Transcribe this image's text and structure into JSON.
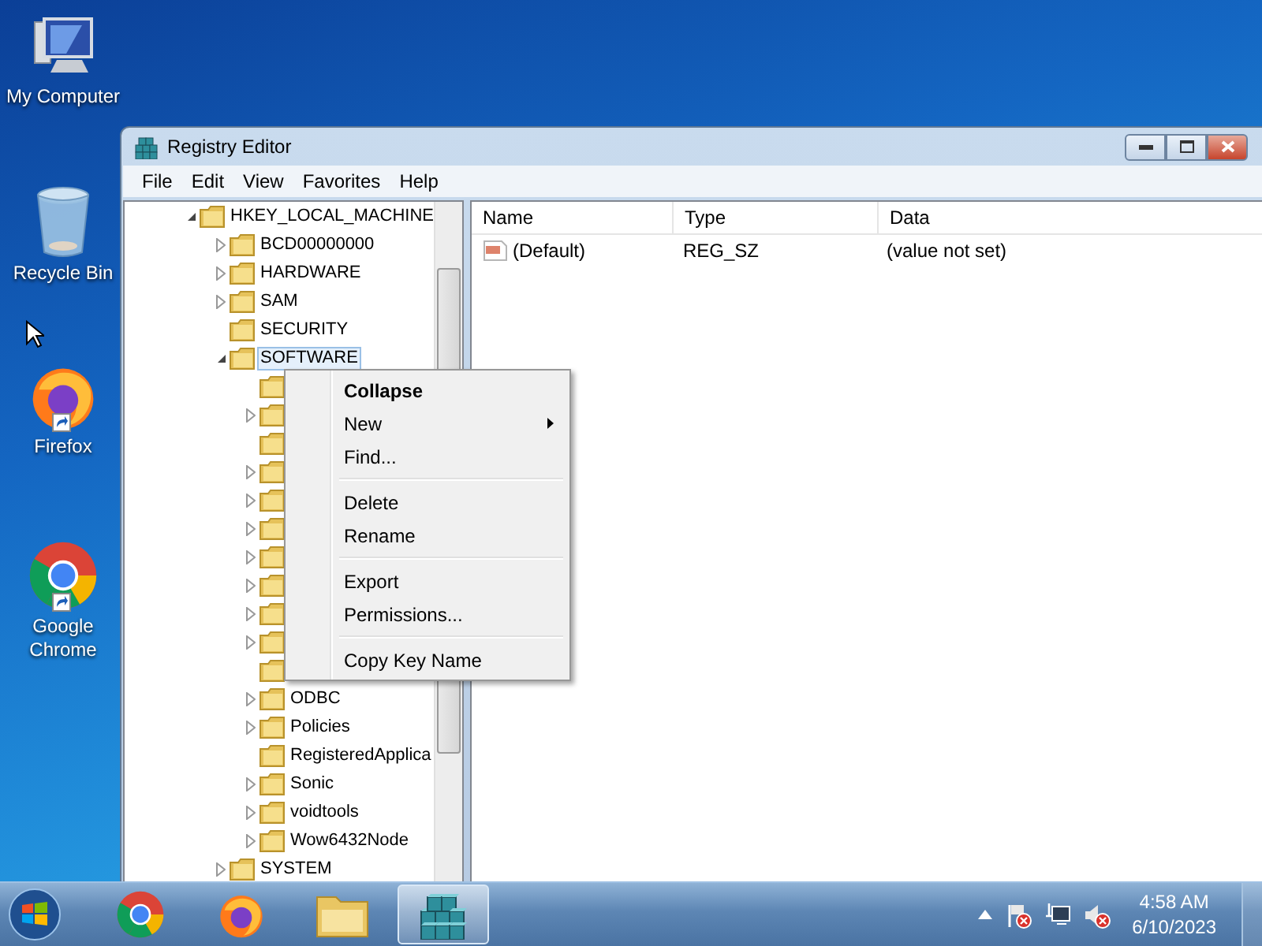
{
  "desktop_icons": [
    {
      "kind": "computer",
      "label": "My Computer"
    },
    {
      "kind": "recycle",
      "label": "Recycle Bin"
    },
    {
      "kind": "firefox",
      "label": "Firefox"
    },
    {
      "kind": "chrome",
      "label": "Google Chrome"
    }
  ],
  "window": {
    "title": "Registry Editor"
  },
  "menu_bar": [
    "File",
    "Edit",
    "View",
    "Favorites",
    "Help"
  ],
  "tree": [
    {
      "label": "HKEY_LOCAL_MACHINE",
      "expandable": true,
      "expanded": true,
      "selected": false,
      "children": [
        {
          "label": "BCD00000000",
          "expandable": true,
          "expanded": false,
          "selected": false
        },
        {
          "label": "HARDWARE",
          "expandable": true,
          "expanded": false,
          "selected": false
        },
        {
          "label": "SAM",
          "expandable": true,
          "expanded": false,
          "selected": false
        },
        {
          "label": "SECURITY",
          "expandable": false,
          "expanded": false,
          "selected": false
        },
        {
          "label": "SOFTWARE",
          "expandable": true,
          "expanded": true,
          "selected": true,
          "children": [
            {
              "expandable": false,
              "expanded": false,
              "selected": false
            },
            {
              "expandable": true,
              "expanded": false,
              "selected": false
            },
            {
              "expandable": false,
              "expanded": false,
              "selected": false
            },
            {
              "expandable": true,
              "expanded": false,
              "selected": false
            },
            {
              "expandable": true,
              "expanded": false,
              "selected": false
            },
            {
              "expandable": true,
              "expanded": false,
              "selected": false
            },
            {
              "expandable": true,
              "expanded": false,
              "selected": false
            },
            {
              "expandable": true,
              "expanded": false,
              "selected": false
            },
            {
              "expandable": true,
              "expanded": false,
              "selected": false
            },
            {
              "expandable": true,
              "expanded": false,
              "selected": false
            },
            {
              "expandable": false,
              "expanded": false,
              "selected": false
            },
            {
              "label": "ODBC",
              "expandable": true,
              "expanded": false,
              "selected": false
            },
            {
              "label": "Policies",
              "expandable": true,
              "expanded": false,
              "selected": false
            },
            {
              "label": "RegisteredApplica",
              "expandable": false,
              "expanded": false,
              "selected": false
            },
            {
              "label": "Sonic",
              "expandable": true,
              "expanded": false,
              "selected": false
            },
            {
              "label": "voidtools",
              "expandable": true,
              "expanded": false,
              "selected": false
            },
            {
              "label": "Wow6432Node",
              "expandable": true,
              "expanded": false,
              "selected": false
            }
          ]
        },
        {
          "label": "SYSTEM",
          "expandable": true,
          "expanded": false,
          "selected": false
        }
      ]
    }
  ],
  "values_table": {
    "columns": [
      "Name",
      "Type",
      "Data"
    ],
    "rows": [
      {
        "name": "(Default)",
        "type": "REG_SZ",
        "data": "(value not set)"
      }
    ]
  },
  "context_menu": [
    {
      "kind": "item",
      "label": "Collapse",
      "default": true,
      "submenu": false
    },
    {
      "kind": "item",
      "label": "New",
      "default": false,
      "submenu": true
    },
    {
      "kind": "item",
      "label": "Find...",
      "default": false,
      "submenu": false
    },
    {
      "kind": "separator"
    },
    {
      "kind": "item",
      "label": "Delete",
      "default": false,
      "submenu": false
    },
    {
      "kind": "item",
      "label": "Rename",
      "default": false,
      "submenu": false
    },
    {
      "kind": "separator"
    },
    {
      "kind": "item",
      "label": "Export",
      "default": false,
      "submenu": false
    },
    {
      "kind": "item",
      "label": "Permissions...",
      "default": false,
      "submenu": false
    },
    {
      "kind": "separator"
    },
    {
      "kind": "item",
      "label": "Copy Key Name",
      "default": false,
      "submenu": false
    }
  ],
  "taskbar": {
    "apps": [
      {
        "kind": "chrome",
        "selected": false
      },
      {
        "kind": "firefox",
        "selected": false
      },
      {
        "kind": "explorer",
        "selected": false
      },
      {
        "kind": "regedit",
        "selected": true
      }
    ],
    "tray": [
      {
        "kind": "flag"
      },
      {
        "kind": "network"
      },
      {
        "kind": "volume"
      }
    ],
    "time": "4:58 AM",
    "date": "6/10/2023"
  }
}
